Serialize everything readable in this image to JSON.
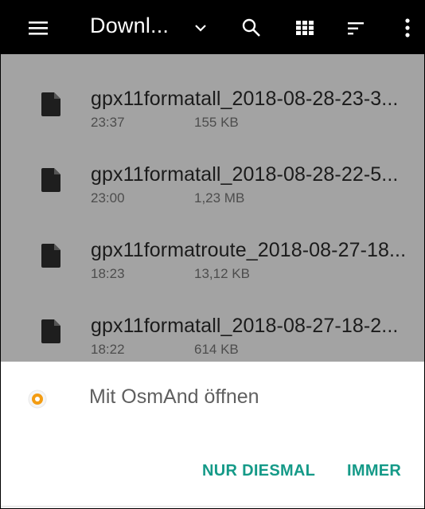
{
  "toolbar": {
    "title": "Downl...",
    "menu_icon": "hamburger-menu-icon",
    "dropdown_icon": "chevron-down-icon",
    "search_icon": "search-icon",
    "grid_icon": "grid-view-icon",
    "sort_icon": "sort-icon",
    "more_icon": "more-vertical-icon"
  },
  "files": [
    {
      "name": "gpx11formatall_2018-08-28-23-3...",
      "time": "23:37",
      "size": "155 KB"
    },
    {
      "name": "gpx11formatall_2018-08-28-22-5...",
      "time": "23:00",
      "size": "1,23 MB"
    },
    {
      "name": "gpx11formatroute_2018-08-27-18...",
      "time": "18:23",
      "size": "13,12 KB"
    },
    {
      "name": "gpx11formatall_2018-08-27-18-2...",
      "time": "18:22",
      "size": "614 KB"
    }
  ],
  "dialog": {
    "title": "Mit OsmAnd öffnen",
    "app_icon": "osmand-app-icon",
    "once_label": "NUR DIESMAL",
    "always_label": "IMMER"
  },
  "colors": {
    "toolbar_bg": "#000000",
    "scrim_bg": "#a3a3a3",
    "accent": "#159a88",
    "osmand_orange": "#f39c12"
  }
}
